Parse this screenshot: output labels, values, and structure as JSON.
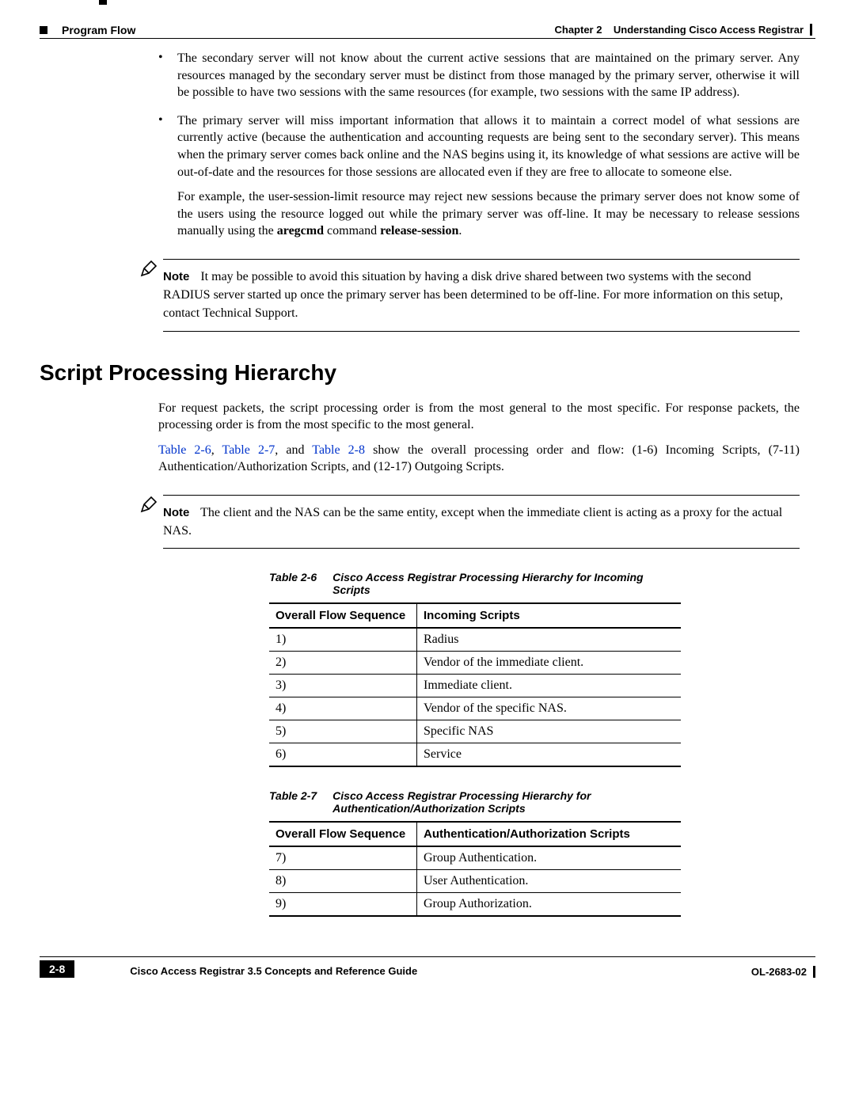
{
  "header": {
    "section": "Program Flow",
    "chapter_label": "Chapter 2",
    "chapter_title": "Understanding Cisco Access Registrar"
  },
  "bullets": [
    {
      "text": "The secondary server will not know about the current active sessions that are maintained on the primary server. Any resources managed by the secondary server must be distinct from those managed by the primary server, otherwise it will be possible to have two sessions with the same resources (for example, two sessions with the same IP address)."
    },
    {
      "text": "The primary server will miss important information that allows it to maintain a correct model of what sessions are currently active (because the authentication and accounting requests are being sent to the secondary server). This means when the primary server comes back online and the NAS begins using it, its knowledge of what sessions are active will be out-of-date and the resources for those sessions are allocated even if they are free to allocate to someone else.",
      "sub_pre": "For example, the user-session-limit resource may reject new sessions because the primary server does not know some of the users using the resource logged out while the primary server was off-line. It may be necessary to release sessions manually using the ",
      "cmd1": "aregcmd",
      "mid": " command ",
      "cmd2": "release-session",
      "post": "."
    }
  ],
  "note1": {
    "label": "Note",
    "text": "It may be possible to avoid this situation by having a disk drive shared between two systems with the second RADIUS server started up once the primary server has been determined to be off-line. For more information on this setup, contact Technical Support."
  },
  "section_heading": "Script Processing Hierarchy",
  "intro": {
    "p1": "For request packets, the script processing order is from the most general to the most specific. For response packets, the processing order is from the most specific to the most general.",
    "link1": "Table 2-6",
    "sep1": ", ",
    "link2": "Table 2-7",
    "sep2": ", and ",
    "link3": "Table 2-8",
    "rest": " show the overall processing order and flow: (1-6) Incoming Scripts, (7-11) Authentication/Authorization Scripts, and (12-17) Outgoing Scripts."
  },
  "note2": {
    "label": "Note",
    "text": "The client and the NAS can be the same entity, except when the immediate client is acting as a proxy for the actual NAS."
  },
  "table26": {
    "caption_label": "Table 2-6",
    "caption_title": "Cisco Access Registrar Processing Hierarchy for Incoming Scripts",
    "col1": "Overall Flow Sequence",
    "col2": "Incoming Scripts",
    "rows": [
      {
        "seq": "1)",
        "val": "Radius"
      },
      {
        "seq": "2)",
        "val": "Vendor of the immediate client."
      },
      {
        "seq": "3)",
        "val": "Immediate client."
      },
      {
        "seq": "4)",
        "val": "Vendor of the specific NAS."
      },
      {
        "seq": "5)",
        "val": "Specific NAS"
      },
      {
        "seq": "6)",
        "val": "Service"
      }
    ]
  },
  "table27": {
    "caption_label": "Table 2-7",
    "caption_title": "Cisco Access Registrar Processing Hierarchy for Authentication/Authorization Scripts",
    "col1": "Overall Flow Sequence",
    "col2": "Authentication/Authorization Scripts",
    "rows": [
      {
        "seq": "7)",
        "val": "Group Authentication."
      },
      {
        "seq": "8)",
        "val": "User Authentication."
      },
      {
        "seq": "9)",
        "val": "Group Authorization."
      }
    ]
  },
  "footer": {
    "doc_title": "Cisco Access Registrar 3.5 Concepts and Reference Guide",
    "page_num": "2-8",
    "doc_id": "OL-2683-02"
  }
}
